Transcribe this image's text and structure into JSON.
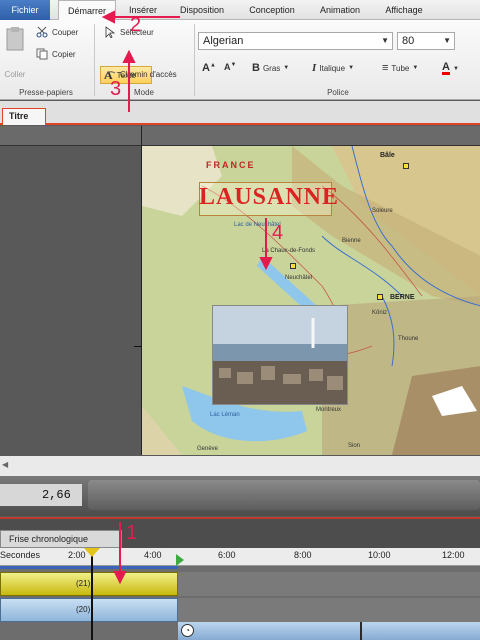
{
  "ribbon": {
    "tabs": [
      "Fichier",
      "Démarrer",
      "Insérer",
      "Disposition",
      "Conception",
      "Animation",
      "Affichage"
    ],
    "clipboard": {
      "paste": "Coller",
      "cut": "Couper",
      "copy": "Copier",
      "group": "Presse-papiers"
    },
    "mode": {
      "selector": "Sélecteur",
      "text": "Texte",
      "path": "Chemin d'accès",
      "group": "Mode"
    },
    "font": {
      "family": "Algerian",
      "size": "80",
      "bold": "Gras",
      "italic": "Italique",
      "line": "Tube",
      "group": "Police"
    }
  },
  "document": {
    "tab": "Titre"
  },
  "slide": {
    "title": "LAUSANNE",
    "country": "FRANCE",
    "cities": [
      "Bâle",
      "La Chaux-de-Fonds",
      "Neuchâtel",
      "Bienne",
      "Soleure",
      "BERNE",
      "Köniz",
      "Thoune",
      "Montreux",
      "Sion",
      "Genève",
      "Lac Léman",
      "Lac de Neuchâtel"
    ]
  },
  "transport": {
    "time": "2,66"
  },
  "timeline": {
    "tab": "Frise chronologique",
    "unit": "Secondes",
    "ticks": [
      "2:00",
      "4:00",
      "6:00",
      "8:00",
      "10:00",
      "12:00"
    ],
    "tracks": [
      {
        "label": "(21)"
      },
      {
        "label": "(20)"
      }
    ]
  },
  "annotations": [
    "1",
    "2",
    "3",
    "4"
  ],
  "colors": {
    "accent_red": "#e31b4e",
    "file_tab": "#2f5fa9",
    "title_red": "#d22222"
  }
}
